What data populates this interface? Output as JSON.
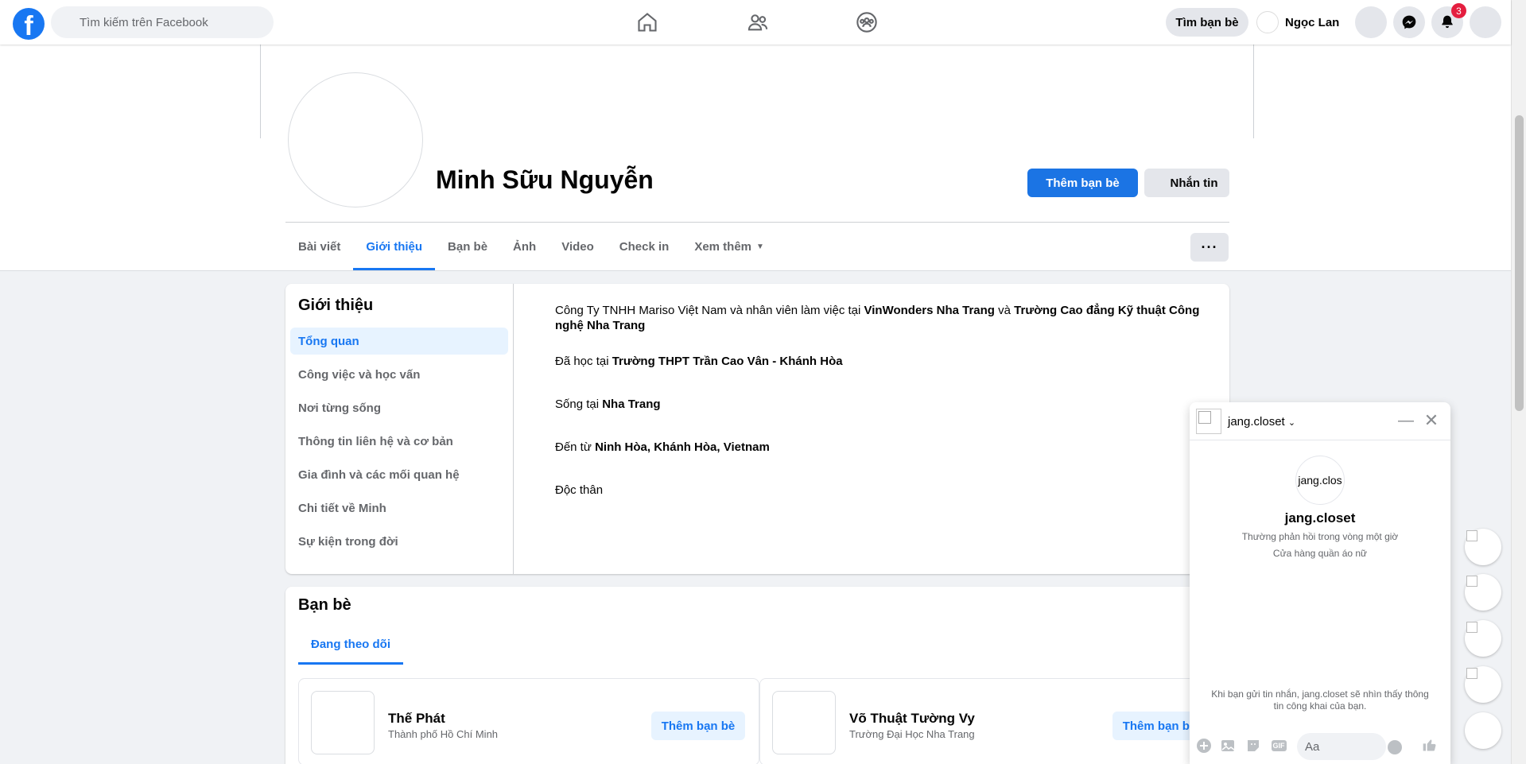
{
  "topbar": {
    "logo": "f",
    "search_placeholder": "Tìm kiếm trên Facebook",
    "find_friends": "Tìm bạn bè",
    "user_name": "Ngọc Lan",
    "notification_count": "3"
  },
  "profile": {
    "name": "Minh Sữu Nguyễn",
    "add_friend": "Thêm bạn bè",
    "message": "Nhắn tin"
  },
  "tabs": [
    "Bài viết",
    "Giới thiệu",
    "Bạn bè",
    "Ảnh",
    "Video",
    "Check in",
    "Xem thêm"
  ],
  "more_button": "···",
  "about": {
    "title": "Giới thiệu",
    "nav": [
      "Tổng quan",
      "Công việc và học vấn",
      "Nơi từng sống",
      "Thông tin liên hệ và cơ bản",
      "Gia đình và các mối quan hệ",
      "Chi tiết về Minh",
      "Sự kiện trong đời"
    ],
    "work": {
      "prefix": "Công Ty TNHH Mariso Việt Nam và nhân viên làm việc tại ",
      "place1": "VinWonders Nha Trang",
      "mid": " và ",
      "place2": "Trường Cao đẳng Kỹ thuật Công nghệ Nha Trang"
    },
    "school": {
      "prefix": "Đã học tại ",
      "value": "Trường THPT Trần Cao Vân -  Khánh Hòa"
    },
    "lives": {
      "prefix": "Sống tại ",
      "value": "Nha Trang"
    },
    "from": {
      "prefix": "Đến từ ",
      "value": "Ninh Hòa, Khánh Hòa, Vietnam"
    },
    "relationship": "Độc thân"
  },
  "friends": {
    "title": "Bạn bè",
    "tab": "Đang theo dõi",
    "items": [
      {
        "name": "Thế Phát",
        "sub": "Thành phố Hồ Chí Minh",
        "action": "Thêm bạn bè"
      },
      {
        "name": "Võ Thuật Tường Vy",
        "sub": "Trường Đại Học Nha Trang",
        "action": "Thêm bạn bè"
      }
    ]
  },
  "chat": {
    "name": "jang.closet",
    "avatar_alt": "jang.clos",
    "response": "Thường phản hồi trong vòng một giờ",
    "category": "Cửa hàng quần áo nữ",
    "notice": "Khi bạn gửi tin nhắn, jang.closet sẽ nhìn thấy thông tin công khai của bạn.",
    "input_placeholder": "Aa",
    "gif": "GIF"
  },
  "colors": {
    "accent": "#1877f2",
    "badge": "#e41e3f",
    "background": "#f0f2f5"
  }
}
